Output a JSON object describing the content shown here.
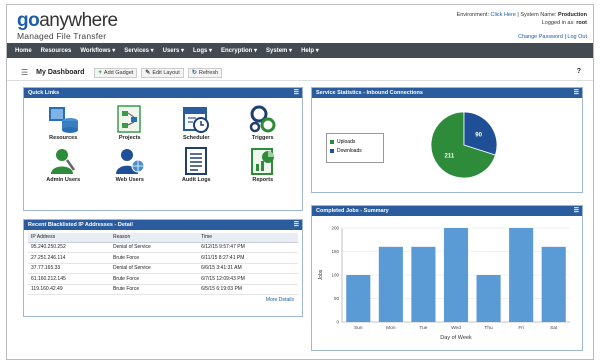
{
  "brand": {
    "logo_go": "go",
    "logo_rest": "anywhere",
    "tagline": "Managed File Transfer"
  },
  "topinfo": {
    "env_label": "Environment:",
    "env_link": "Click Here",
    "sys_label": "| System Name:",
    "sys_value": "Production",
    "logged_label": "Logged in as:",
    "logged_value": "root",
    "change_password": "Change Password",
    "logout": "Log Out"
  },
  "nav": [
    "Home",
    "Resources",
    "Workflows ▾",
    "Services ▾",
    "Users ▾",
    "Logs ▾",
    "Encryption ▾",
    "System ▾",
    "Help ▾"
  ],
  "toolbar": {
    "title": "My Dashboard",
    "add_gadget": "Add Gadget",
    "edit_layout": "Edit Layout",
    "refresh": "Refresh",
    "help": "?"
  },
  "quick_links": {
    "title": "Quick Links",
    "items": [
      {
        "label": "Resources",
        "icon": "resources-icon"
      },
      {
        "label": "Projects",
        "icon": "projects-icon"
      },
      {
        "label": "Scheduler",
        "icon": "scheduler-icon"
      },
      {
        "label": "Triggers",
        "icon": "triggers-icon"
      },
      {
        "label": "Admin Users",
        "icon": "admin-users-icon"
      },
      {
        "label": "Web Users",
        "icon": "web-users-icon"
      },
      {
        "label": "Audit Logs",
        "icon": "audit-logs-icon"
      },
      {
        "label": "Reports",
        "icon": "reports-icon"
      }
    ]
  },
  "blacklist": {
    "title": "Recent Blacklisted IP Addresses - Detail",
    "columns": [
      "IP Address",
      "Reason",
      "Time"
    ],
    "rows": [
      [
        "95.240.250.252",
        "Denial of Service",
        "6/12/15 9:57:47 PM"
      ],
      [
        "27.251.246.114",
        "Brute Force",
        "6/11/15 8:27:41 PM"
      ],
      [
        "37.77.165.33",
        "Denial of Service",
        "6/6/15 3:41:31 AM"
      ],
      [
        "61.160.212.145",
        "Brute Force",
        "6/7/15 12:09:43 PM"
      ],
      [
        "119.160.42.49",
        "Brute Force",
        "6/5/15 6:19:03 PM"
      ]
    ],
    "more": "More Details"
  },
  "service_stats": {
    "title": "Service Statistics - Inbound Connections",
    "legend": [
      "Uploads",
      "Downloads"
    ],
    "colors": {
      "uploads": "#2e8b3a",
      "downloads": "#1f4f96"
    }
  },
  "completed_jobs": {
    "title": "Completed Jobs - Summary",
    "bar_color": "#5b9bd5"
  },
  "chart_data": [
    {
      "type": "pie",
      "title": "Service Statistics - Inbound Connections",
      "labels": [
        "Uploads",
        "Downloads"
      ],
      "values": [
        211,
        90
      ]
    },
    {
      "type": "bar",
      "title": "Completed Jobs - Summary",
      "categories": [
        "Sun",
        "Mon",
        "Tue",
        "Wed",
        "Thu",
        "Fri",
        "Sat"
      ],
      "values": [
        100,
        160,
        160,
        200,
        100,
        200,
        160
      ],
      "xlabel": "Day of Week",
      "ylabel": "Jobs",
      "yticks": [
        "0",
        "50",
        "100",
        "150",
        "200"
      ],
      "ylim": [
        0,
        200
      ]
    }
  ]
}
